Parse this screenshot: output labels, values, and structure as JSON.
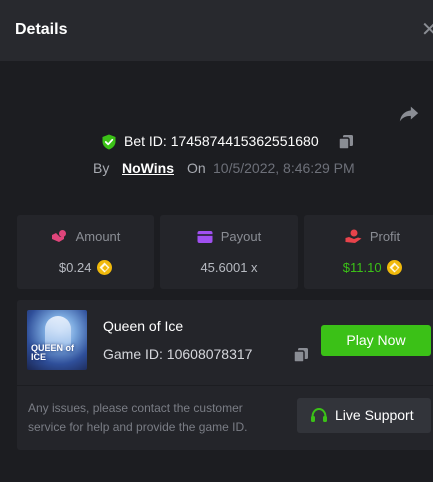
{
  "header": {
    "title": "Details",
    "close_glyph": "✕"
  },
  "bet": {
    "label_prefix": "Bet ID: ",
    "id": "1745874415362551680",
    "by_label": "By",
    "user": "NoWins",
    "on_label": "On",
    "datetime": "10/5/2022, 8:46:29 PM"
  },
  "stats": {
    "amount": {
      "label": "Amount",
      "value": "$0.24",
      "icon": "coins-stack-icon",
      "color": "#e0457b"
    },
    "payout": {
      "label": "Payout",
      "value": "45.6001 x",
      "icon": "wallet-icon",
      "color": "#a050f0"
    },
    "profit": {
      "label": "Profit",
      "value": "$11.10",
      "icon": "hand-coin-icon",
      "color": "#e8434b",
      "value_color": "#3bc117"
    }
  },
  "game": {
    "name": "Queen of Ice",
    "id_label": "Game ID: ",
    "id": "10608078317",
    "thumb_text": "QUEEN of\nICE",
    "play_label": "Play Now"
  },
  "support": {
    "text": "Any issues, please contact the customer service for help and provide the game ID.",
    "button_label": "Live Support",
    "icon": "headset-icon"
  },
  "colors": {
    "accent_green": "#3bc117",
    "coin": "#f0b90b",
    "shield": "#3bc117"
  }
}
